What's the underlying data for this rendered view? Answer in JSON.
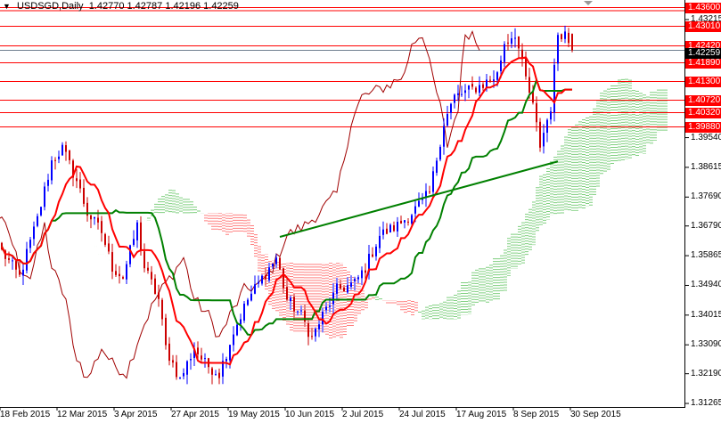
{
  "header": {
    "symbol": "USDSGD,Daily",
    "ohlc": "1.42770 1.42787 1.42196 1.42259"
  },
  "chart_data": {
    "type": "candlestick",
    "title": "USDSGD,Daily",
    "indicator": "Ichimoku Kinko Hyo (9,26,52)",
    "ylim": [
      1.31,
      1.438
    ],
    "y_ticks": [
      "1.43215",
      "1.39540",
      "1.38615",
      "1.37690",
      "1.36790",
      "1.35865",
      "1.34940",
      "1.34015",
      "1.33090",
      "1.32190",
      "1.31265"
    ],
    "x_ticks": [
      {
        "bar": 0,
        "label": "18 Feb 2015"
      },
      {
        "bar": 16,
        "label": "12 Mar 2015"
      },
      {
        "bar": 32,
        "label": "3 Apr 2015"
      },
      {
        "bar": 48,
        "label": "27 Apr 2015"
      },
      {
        "bar": 64,
        "label": "19 May 2015"
      },
      {
        "bar": 80,
        "label": "10 Jun 2015"
      },
      {
        "bar": 96,
        "label": "2 Jul 2015"
      },
      {
        "bar": 112,
        "label": "24 Jul 2015"
      },
      {
        "bar": 128,
        "label": "17 Aug 2015"
      },
      {
        "bar": 144,
        "label": "8 Sep 2015"
      },
      {
        "bar": 160,
        "label": "30 Sep 2015"
      }
    ],
    "levels": [
      "1.43600",
      "1.43010",
      "1.42420",
      "1.41890",
      "1.41300",
      "1.40720",
      "1.40320",
      "1.39880"
    ],
    "current_price": "1.42259",
    "trendline": [
      [
        78,
        1.3645
      ],
      [
        156,
        1.388
      ]
    ],
    "close_path": [
      [
        0,
        1.36
      ],
      [
        5,
        1.352
      ],
      [
        10,
        1.37
      ],
      [
        14,
        1.388
      ],
      [
        17,
        1.392
      ],
      [
        21,
        1.382
      ],
      [
        24,
        1.372
      ],
      [
        28,
        1.366
      ],
      [
        31,
        1.355
      ],
      [
        34,
        1.352
      ],
      [
        38,
        1.368
      ],
      [
        40,
        1.355
      ],
      [
        44,
        1.345
      ],
      [
        46,
        1.33
      ],
      [
        50,
        1.32
      ],
      [
        54,
        1.33
      ],
      [
        57,
        1.325
      ],
      [
        61,
        1.322
      ],
      [
        65,
        1.335
      ],
      [
        69,
        1.345
      ],
      [
        72,
        1.35
      ],
      [
        77,
        1.358
      ],
      [
        80,
        1.345
      ],
      [
        84,
        1.34
      ],
      [
        87,
        1.333
      ],
      [
        90,
        1.34
      ],
      [
        94,
        1.348
      ],
      [
        99,
        1.35
      ],
      [
        102,
        1.355
      ],
      [
        106,
        1.365
      ],
      [
        111,
        1.368
      ],
      [
        115,
        1.372
      ],
      [
        120,
        1.378
      ],
      [
        124,
        1.4
      ],
      [
        127,
        1.408
      ],
      [
        131,
        1.41
      ],
      [
        135,
        1.412
      ],
      [
        139,
        1.415
      ],
      [
        141,
        1.425
      ],
      [
        144,
        1.428
      ],
      [
        146,
        1.418
      ],
      [
        149,
        1.405
      ],
      [
        151,
        1.393
      ],
      [
        154,
        1.405
      ],
      [
        156,
        1.428
      ],
      [
        158,
        1.428
      ],
      [
        160,
        1.4226
      ]
    ],
    "colors": {
      "bull": "#0000ff",
      "bear": "#cc0000",
      "tenkan": "#ff0000",
      "kijun": "#008000",
      "chikou": "#a00000",
      "cloud_up": "#00a000",
      "cloud_down": "#ff0000",
      "level": "#ff0000",
      "trend": "#008000"
    }
  }
}
